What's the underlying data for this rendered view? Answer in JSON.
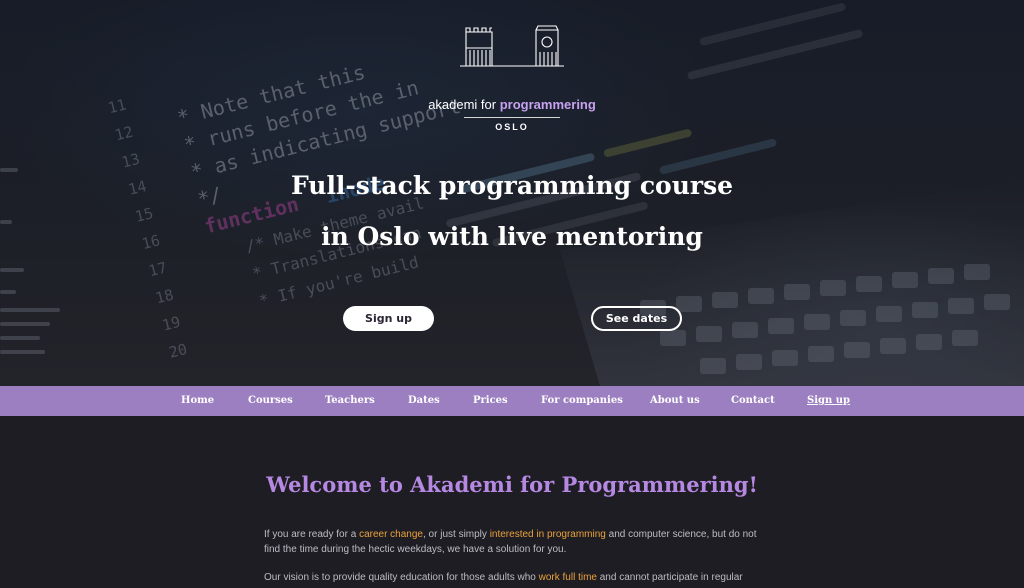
{
  "colors": {
    "accent_purple": "#9c7fc0",
    "heading_purple": "#b589e2",
    "highlight_orange": "#e8a23c",
    "page_bg": "#1f1d24"
  },
  "logo": {
    "name_prefix": "akademi for ",
    "name_bold": "programmering",
    "city": "OSLO",
    "icon": "building-skyline-icon"
  },
  "hero": {
    "title_line1": "Full-stack programming course",
    "title_line2": "in Oslo with live mentoring",
    "signup_label": "Sign up",
    "dates_label": "See dates",
    "background_code": [
      "11",
      "12",
      "13",
      "14",
      "15",
      "16",
      "17",
      "18",
      "19",
      "20",
      "* Note that this",
      "* runs before the in",
      "* as indicating support",
      "*/",
      "function",
      "inode",
      "/* Make theme avail",
      "* Translations can",
      "* If you're build"
    ]
  },
  "nav": {
    "items": [
      "Home",
      "Courses",
      "Teachers",
      "Dates",
      "Prices",
      "For companies",
      "About us",
      "Contact",
      "Sign up"
    ]
  },
  "main": {
    "welcome_title": "Welcome to Akademi for Programmering!",
    "p1_a": "If you are ready for a ",
    "p1_hl1": "career change",
    "p1_b": ", or just simply ",
    "p1_hl2": "interested in programming",
    "p1_c": " and computer science, but do not find the time during the hectic weekdays, we have a solution for you.",
    "p2_a": "Our vision is to provide quality education for those adults who ",
    "p2_hl1": "work full time",
    "p2_b": " and cannot participate in regular"
  }
}
